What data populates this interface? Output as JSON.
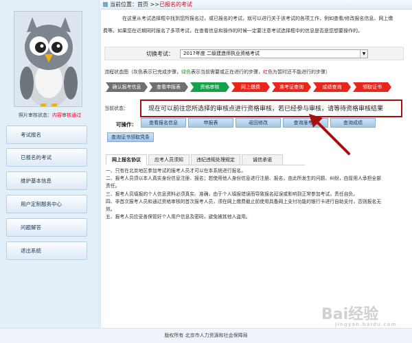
{
  "sidebar": {
    "photo_status_label": "照片审核状态：",
    "photo_status_value": "内容审核通过",
    "items": [
      {
        "label": "考试报名"
      },
      {
        "label": "已报名的考试"
      },
      {
        "label": "维护基本信息"
      },
      {
        "label": "用户定制服务中心"
      },
      {
        "label": "问题解答"
      },
      {
        "label": "退出系统"
      }
    ]
  },
  "breadcrumb": {
    "prefix": "当前位置：首页 >>",
    "current": "已报名的考试"
  },
  "intro": {
    "line1": "在这里从考试选择框中找到您所报名过，或已报名的考试，就可以进行关于该考试的各项工作，例如查看/修改报名信息、网上缴",
    "line2": "费等。如果您在近期同时报名了多项考试，在查看信息和操作的时候一定要注意考试选择框中的信息是否是您想要操作的。"
  },
  "switch": {
    "label": "切换考试：",
    "selected": "2017年度 二级建造师执业资格考试"
  },
  "legend": {
    "prefix": "流程状态图（灰色表示已完成步骤，",
    "green": "绿色",
    "mid": "表示当前需要或正在进行的步骤，",
    "red": "红色",
    "suffix": "为暂时还不能进行的步骤）"
  },
  "steps": [
    {
      "label": "确认报考信息",
      "state": "done"
    },
    {
      "label": "查看申报表",
      "state": "done"
    },
    {
      "label": "资格审核",
      "state": "current"
    },
    {
      "label": "网上缴费",
      "state": "pending"
    },
    {
      "label": "准考证查询",
      "state": "pending"
    },
    {
      "label": "成绩查询",
      "state": "pending"
    },
    {
      "label": "领取证书",
      "state": "pending"
    }
  ],
  "status": {
    "label": "当前状态：",
    "text": "现在可以前往您所选择的审核点进行资格审核，若已经参与审核，请等待资格审核结果"
  },
  "actions": {
    "label": "可操作：",
    "buttons": [
      "查看报名信息",
      "申报表",
      "返回修改",
      "查询准考证",
      "查询成绩",
      "查询证书领取凭条"
    ]
  },
  "tabs": [
    "网上报名协议",
    "应考人员须知",
    "违纪违规处理规定",
    "诚信承诺"
  ],
  "notice": [
    "一、只有在北京地区参加考试的报考人员才可以在本系统进行报名。",
    "二、报考人员须以本人真实身份信息注册、报名；若使用他人身份信息进行注册、报名，由此所发生的问题、纠纷，由冒用人承担全部",
    "责任。",
    "三、报考人员填报的个人信息资料必须真实、准确，由于个人填报错误而导致报名延误或影响到正常参加考试，责任自负。",
    "四、非首次报考人员和通过资格审核的首次报考人员，须在网上缴费截止前使用具备网上支付功能的银行卡进行自助支付，否则报名无",
    "效。",
    "五、报考人员应妥善保管好个人用户信息及密码，避免被其他人盗用。"
  ],
  "footer": "版权所有 北京市人力资源和社会保障局",
  "watermark": {
    "main": "Bai经验",
    "sub": "jingyan.baidu.com"
  },
  "colors": {
    "done": "#6f6f6f",
    "current": "#12a24a",
    "pending": "#e8261c",
    "highlight": "#a60f0f"
  }
}
